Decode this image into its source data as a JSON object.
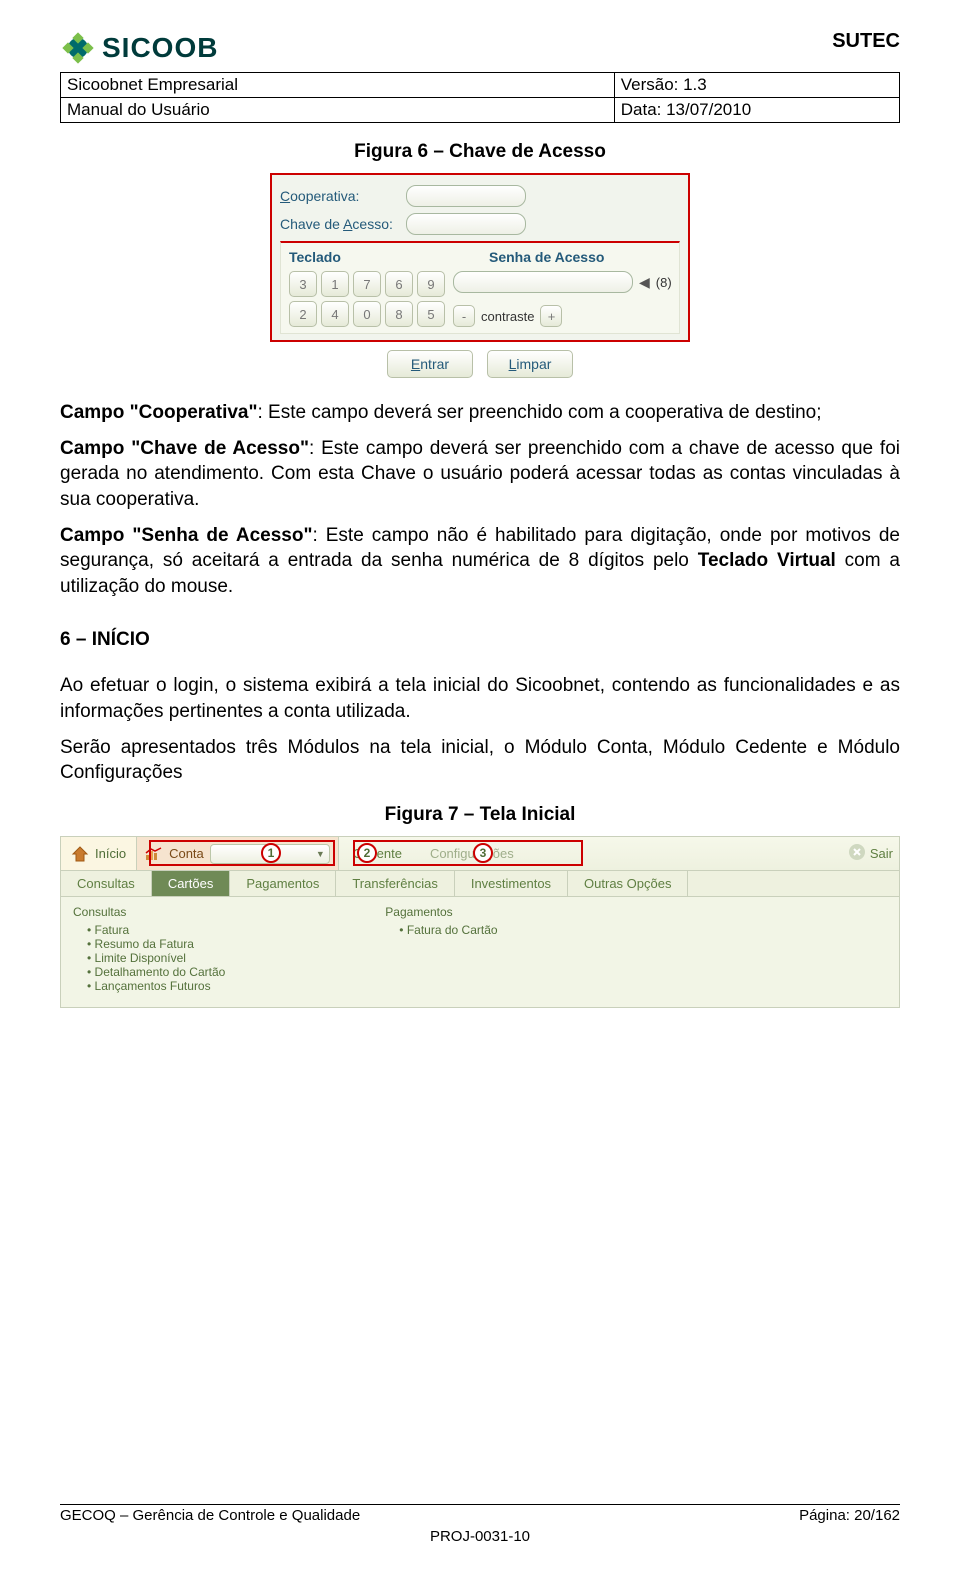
{
  "header": {
    "logo_text": "SICOOB",
    "sutec": "SUTEC"
  },
  "meta": {
    "title": "Sicoobnet Empresarial",
    "version_label": "Versão: 1.3",
    "manual": "Manual do Usuário",
    "date": "Data: 13/07/2010"
  },
  "figure6": {
    "title": "Figura 6 – Chave de Acesso",
    "cooperativa_label": "Cooperativa:",
    "chave_label_pre": "Chave de ",
    "chave_label_und": "A",
    "chave_label_post": "cesso:",
    "teclado": "Teclado",
    "senha": "Senha de Acesso",
    "keys_r1": [
      "3",
      "1",
      "7",
      "6",
      "9"
    ],
    "keys_r2": [
      "2",
      "4",
      "0",
      "8",
      "5"
    ],
    "count": "(8)",
    "minus": "-",
    "plus": "+",
    "contraste": "contraste",
    "btn_entrar_pre": "",
    "btn_entrar_und": "E",
    "btn_entrar_post": "ntrar",
    "btn_limpar_pre": "",
    "btn_limpar_und": "L",
    "btn_limpar_post": "impar"
  },
  "body": {
    "p1_b": "Campo \"Cooperativa\"",
    "p1_t": ": Este campo deverá ser preenchido com a cooperativa de destino;",
    "p2_b": "Campo \"Chave de Acesso\"",
    "p2_t": ": Este campo deverá ser preenchido com a chave de acesso que foi gerada no atendimento. Com esta Chave o usuário poderá acessar todas as contas vinculadas à sua cooperativa.",
    "p3_b": "Campo \"Senha de Acesso\"",
    "p3_m1": ": Este campo não é habilitado para digitação, onde por motivos de segurança, só aceitará a entrada da senha numérica de 8 dígitos pelo ",
    "p3_b2": "Teclado Virtual",
    "p3_m2": " com a utilização do mouse.",
    "h6": "6 – INÍCIO",
    "p4": "Ao efetuar o login, o sistema exibirá a tela inicial do Sicoobnet, contendo as funcionalidades e as informações pertinentes a conta utilizada.",
    "p5": "Serão apresentados três Módulos na tela inicial, o Módulo Conta, Módulo Cedente e Módulo Configurações"
  },
  "figure7": {
    "title": "Figura 7 – Tela Inicial",
    "inicio": "Início",
    "conta": "Conta",
    "cedente": "Cedente",
    "config": "Configurações",
    "sair": "Sair",
    "marks": {
      "m1": "1",
      "m2": "2",
      "m3": "3"
    },
    "nav2": [
      "Consultas",
      "Cartões",
      "Pagamentos",
      "Transferências",
      "Investimentos",
      "Outras Opções"
    ],
    "left_h": "Consultas",
    "left_items": [
      "Fatura",
      "Resumo da Fatura",
      "Limite Disponível",
      "Detalhamento do Cartão",
      "Lançamentos Futuros"
    ],
    "right_h": "Pagamentos",
    "right_items": [
      "Fatura do Cartão"
    ]
  },
  "footer": {
    "left": "GECOQ – Gerência de Controle e Qualidade",
    "right": "Página: 20/162",
    "proj": "PROJ-0031-10"
  }
}
